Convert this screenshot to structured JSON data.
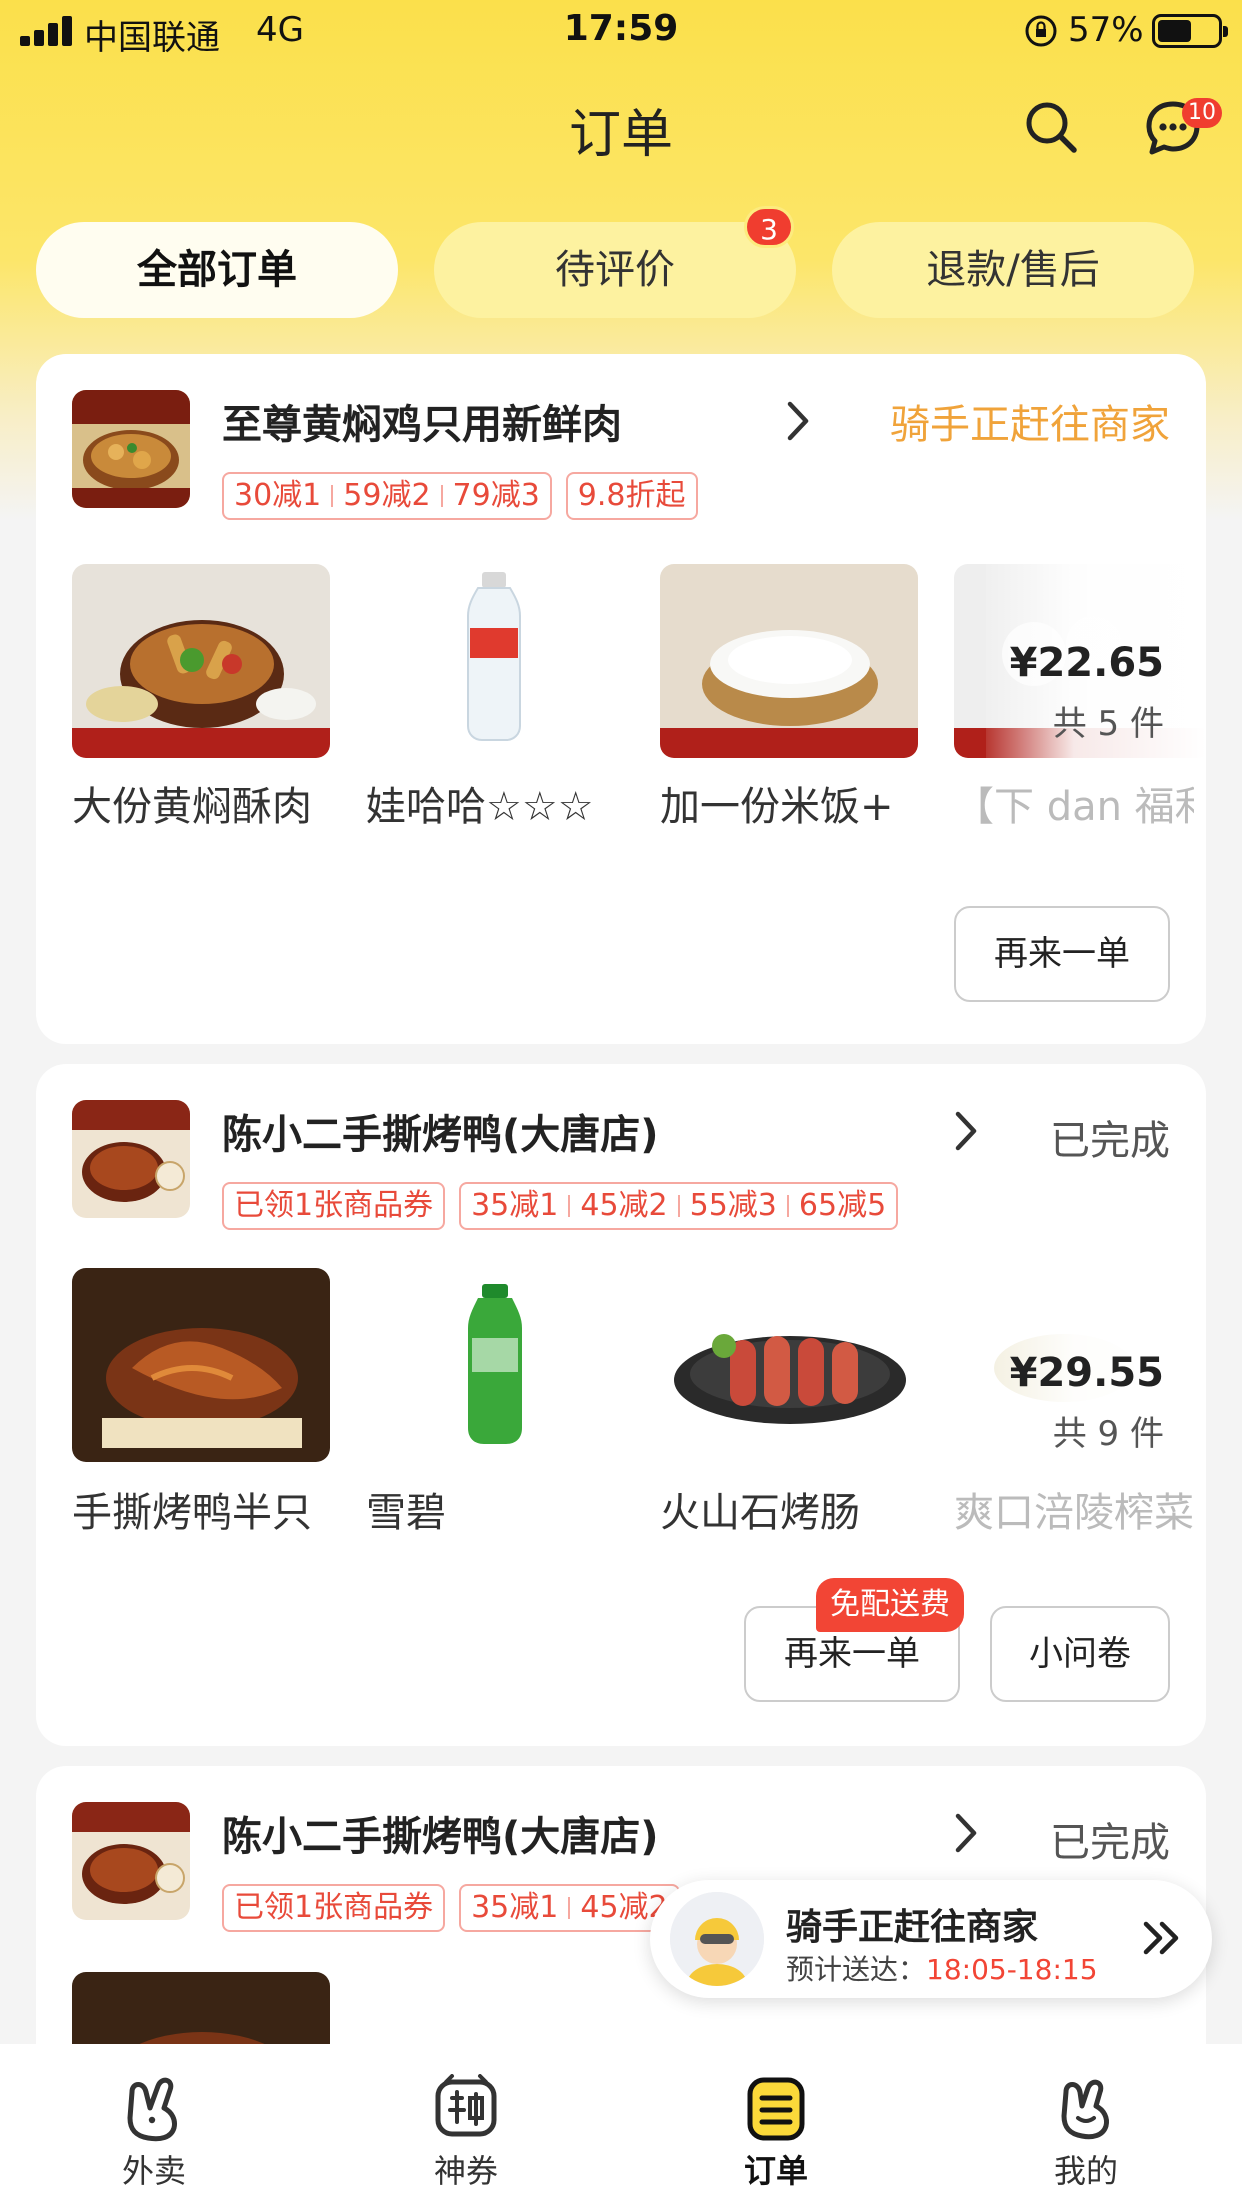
{
  "status_bar": {
    "carrier": "中国联通",
    "network": "4G",
    "time": "17:59",
    "battery": "57%",
    "battery_level": 0.57
  },
  "header": {
    "title": "订单",
    "search_icon": "search-icon",
    "message_icon": "message-icon",
    "message_badge": "10"
  },
  "tabs": [
    {
      "label": "全部订单",
      "active": true
    },
    {
      "label": "待评价",
      "badge": "3"
    },
    {
      "label": "退款/售后"
    }
  ],
  "orders": [
    {
      "shop": "至尊黄焖鸡只用新鲜肉",
      "status": "骑手正赶往商家",
      "status_color": "#f0a33a",
      "tags": [
        {
          "parts": [
            "30减1",
            "59减2",
            "79减3"
          ]
        },
        {
          "parts": [
            "9.8折起"
          ]
        }
      ],
      "items": [
        "大份黄焖酥肉",
        "娃哈哈☆☆☆",
        "加一份米饭+",
        "【下 dan 福利"
      ],
      "total_price": "¥22.65",
      "total_count": "共 5 件",
      "buttons": [
        "再来一单"
      ]
    },
    {
      "shop": "陈小二手撕烤鸭(大唐店)",
      "status": "已完成",
      "status_color": "#555555",
      "tags": [
        {
          "parts": [
            "已领1张商品券"
          ]
        },
        {
          "parts": [
            "35减1",
            "45减2",
            "55减3",
            "65减5"
          ]
        }
      ],
      "items": [
        "手撕烤鸭半只",
        "雪碧",
        "火山石烤肠",
        "爽口涪陵榨菜"
      ],
      "total_price": "¥29.55",
      "total_count": "共 9 件",
      "buttons": [
        "再来一单",
        "小问卷"
      ],
      "promo": "免配送费"
    },
    {
      "shop": "陈小二手撕烤鸭(大唐店)",
      "status": "已完成",
      "status_color": "#555555",
      "tags": [
        {
          "parts": [
            "已领1张商品券"
          ]
        },
        {
          "parts": [
            "35减1",
            "45减2"
          ]
        }
      ]
    }
  ],
  "rider_bar": {
    "status": "骑手正赶往商家",
    "eta_label": "预计送达：",
    "eta_time": "18:05-18:15"
  },
  "bottom_nav": [
    {
      "label": "外卖",
      "icon": "rabbit-icon"
    },
    {
      "label": "神券",
      "icon": "coupon-icon"
    },
    {
      "label": "订单",
      "icon": "order-icon",
      "active": true
    },
    {
      "label": "我的",
      "icon": "profile-icon"
    }
  ]
}
